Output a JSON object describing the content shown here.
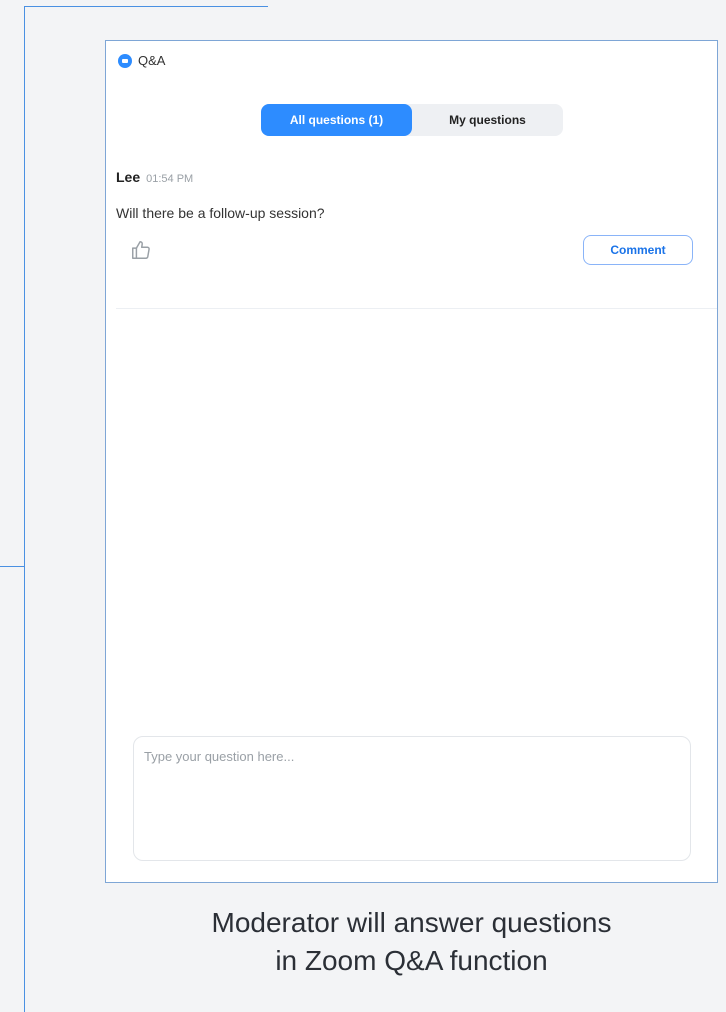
{
  "window": {
    "title": "Q&A"
  },
  "tabs": [
    {
      "label": "All questions (1)",
      "active": true
    },
    {
      "label": "My questions",
      "active": false
    }
  ],
  "question": {
    "author": "Lee",
    "time": "01:54 PM",
    "text": "Will there be a follow-up session?",
    "like_icon": "thumbs-up-icon",
    "comment_label": "Comment"
  },
  "input": {
    "placeholder": "Type your question here..."
  },
  "caption": {
    "line1": "Moderator will answer questions",
    "line2": "in Zoom Q&A function"
  },
  "colors": {
    "accent": "#2d8cff",
    "frame_line": "#4a90e2"
  }
}
